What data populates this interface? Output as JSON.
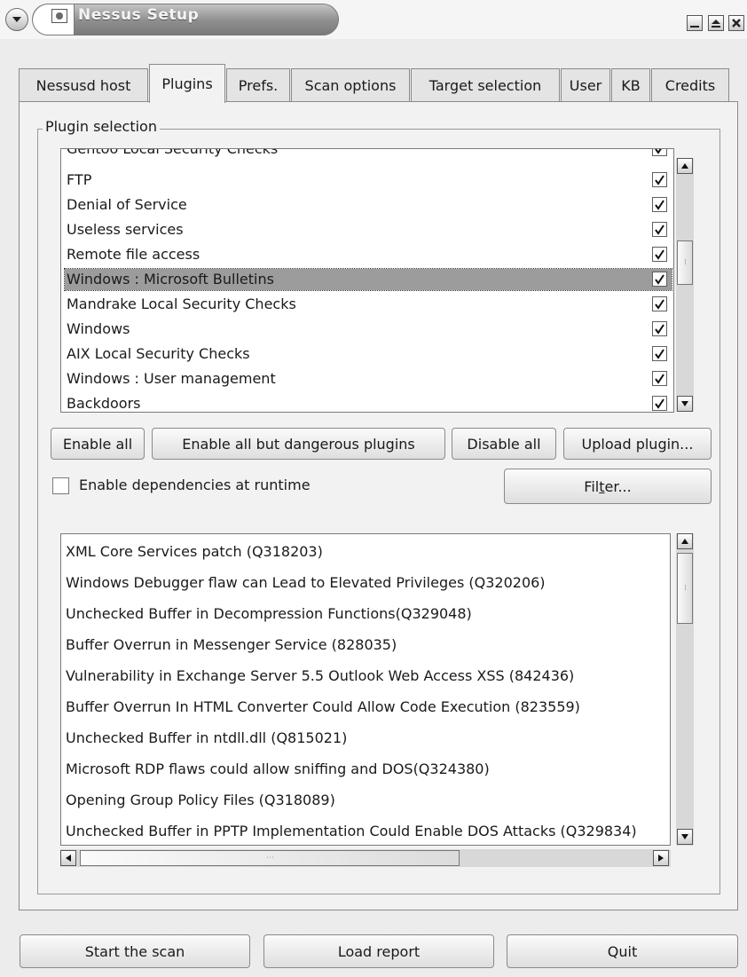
{
  "window": {
    "title": "Nessus Setup"
  },
  "tabs": [
    {
      "label": "Nessusd host",
      "active": false
    },
    {
      "label": "Plugins",
      "active": true
    },
    {
      "label": "Prefs.",
      "active": false
    },
    {
      "label": "Scan options",
      "active": false
    },
    {
      "label": "Target selection",
      "active": false
    },
    {
      "label": "User",
      "active": false
    },
    {
      "label": "KB",
      "active": false
    },
    {
      "label": "Credits",
      "active": false
    }
  ],
  "plugin_selection": {
    "legend": "Plugin selection",
    "families": [
      {
        "label": "Gentoo Local Security Checks",
        "checked": true,
        "selected": false
      },
      {
        "label": "FTP",
        "checked": true,
        "selected": false
      },
      {
        "label": "Denial of Service",
        "checked": true,
        "selected": false
      },
      {
        "label": "Useless services",
        "checked": true,
        "selected": false
      },
      {
        "label": "Remote file access",
        "checked": true,
        "selected": false
      },
      {
        "label": "Windows : Microsoft Bulletins",
        "checked": true,
        "selected": true
      },
      {
        "label": "Mandrake Local Security Checks",
        "checked": true,
        "selected": false
      },
      {
        "label": "Windows",
        "checked": true,
        "selected": false
      },
      {
        "label": "AIX Local Security Checks",
        "checked": true,
        "selected": false
      },
      {
        "label": "Windows : User management",
        "checked": true,
        "selected": false
      },
      {
        "label": "Backdoors",
        "checked": true,
        "selected": false
      }
    ],
    "buttons": {
      "enable_all": "Enable all",
      "enable_safe": "Enable all but dangerous plugins",
      "disable_all": "Disable all",
      "upload": "Upload plugin..."
    },
    "dependencies_label": "Enable dependencies at runtime",
    "dependencies_checked": false,
    "filter_label_pre": "Fil",
    "filter_label_mnemonic": "t",
    "filter_label_post": "er...",
    "plugins": [
      "XML Core Services patch (Q318203)",
      "Windows Debugger flaw can Lead to Elevated Privileges (Q320206)",
      "Unchecked Buffer in Decompression Functions(Q329048)",
      "Buffer Overrun in Messenger Service (828035)",
      "Vulnerability in Exchange Server 5.5 Outlook Web Access XSS (842436)",
      "Buffer Overrun In HTML Converter Could Allow Code Execution (823559)",
      "Unchecked Buffer in ntdll.dll (Q815021)",
      "Microsoft RDP flaws could allow sniffing and DOS(Q324380)",
      "Opening Group Policy Files (Q318089)",
      "Unchecked Buffer in PPTP Implementation Could Enable DOS Attacks (Q329834)"
    ]
  },
  "footer": {
    "start_scan": "Start the scan",
    "load_report": "Load report",
    "quit": "Quit"
  }
}
